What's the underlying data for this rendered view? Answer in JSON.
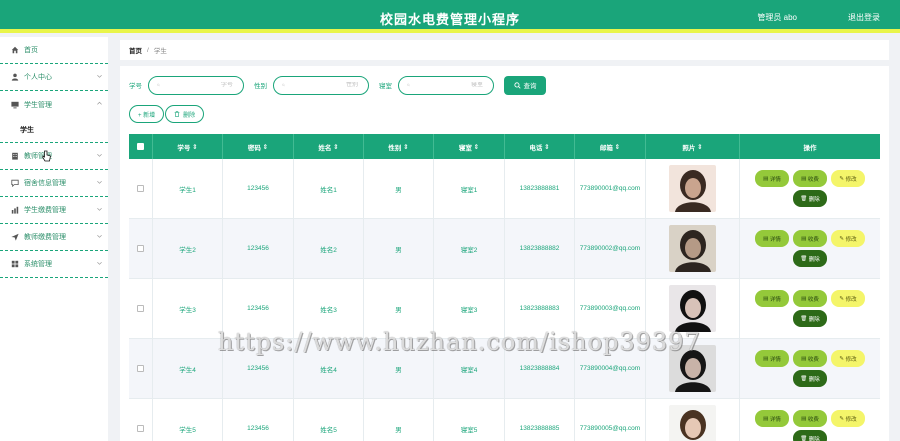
{
  "header": {
    "title": "校园水电费管理小程序",
    "user_label": "管理员 abo",
    "logout_label": "退出登录"
  },
  "sidebar": {
    "items": [
      {
        "label": "首页",
        "icon": "home-icon"
      },
      {
        "label": "个人中心",
        "icon": "user-icon"
      },
      {
        "label": "学生管理",
        "icon": "monitor-icon",
        "sub": "学生"
      },
      {
        "label": "教师管理",
        "icon": "building-icon"
      },
      {
        "label": "宿舍信息管理",
        "icon": "chat-icon"
      },
      {
        "label": "学生缴费管理",
        "icon": "chart-icon"
      },
      {
        "label": "教师缴费管理",
        "icon": "send-icon"
      },
      {
        "label": "系统管理",
        "icon": "grid-icon"
      }
    ]
  },
  "breadcrumb": {
    "home": "首页",
    "separator": "/",
    "current": "学生"
  },
  "search": {
    "fields": [
      {
        "label": "学号",
        "placeholder": "学号"
      },
      {
        "label": "性别",
        "placeholder": "性别"
      },
      {
        "label": "寝室",
        "placeholder": "寝室"
      }
    ],
    "query_label": "查询"
  },
  "actions": {
    "add_label": "+ 新增",
    "delete_label": "删除"
  },
  "table": {
    "headers": [
      "学号",
      "密码",
      "姓名",
      "性别",
      "寝室",
      "电话",
      "邮箱",
      "照片",
      "操作"
    ],
    "rows": [
      {
        "id": "学生1",
        "pwd": "123456",
        "name": "姓名1",
        "gender": "男",
        "room": "寝室1",
        "phone": "13823888881",
        "email": "773890001@qq.com"
      },
      {
        "id": "学生2",
        "pwd": "123456",
        "name": "姓名2",
        "gender": "男",
        "room": "寝室2",
        "phone": "13823888882",
        "email": "773890002@qq.com"
      },
      {
        "id": "学生3",
        "pwd": "123456",
        "name": "姓名3",
        "gender": "男",
        "room": "寝室3",
        "phone": "13823888883",
        "email": "773890003@qq.com"
      },
      {
        "id": "学生4",
        "pwd": "123456",
        "name": "姓名4",
        "gender": "男",
        "room": "寝室4",
        "phone": "13823888884",
        "email": "773890004@qq.com"
      },
      {
        "id": "学生5",
        "pwd": "123456",
        "name": "姓名5",
        "gender": "男",
        "room": "寝室5",
        "phone": "13823888885",
        "email": "773890005@qq.com"
      }
    ],
    "ops": {
      "detail": "详情",
      "charge": "收费",
      "edit": "修改",
      "delete": "删除"
    }
  },
  "watermark": "https://www.huzhan.com/ishop39397",
  "colors": {
    "primary": "#1aa57a",
    "accent_bar": "#e9f54a",
    "op_green": "#94c93a",
    "op_yellow": "#f4f56a",
    "op_dark": "#2d6a18"
  }
}
